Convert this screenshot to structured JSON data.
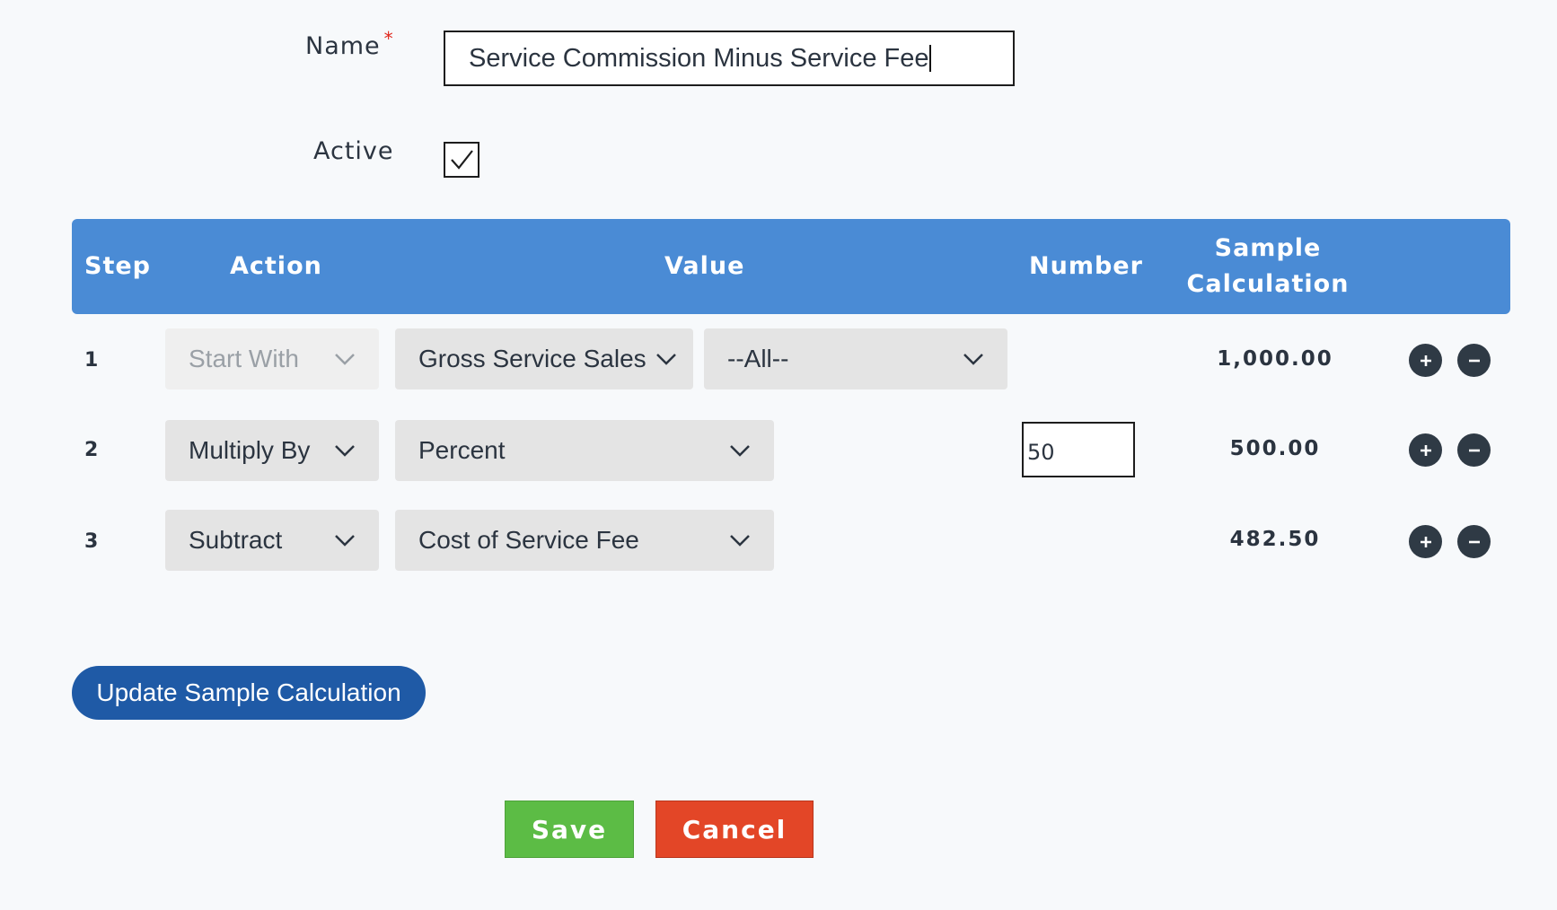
{
  "form": {
    "name_label": "Name",
    "name_required_marker": "*",
    "name_value": "Service Commission Minus Service Fee",
    "active_label": "Active",
    "active_checked": true
  },
  "table": {
    "headers": {
      "step": "Step",
      "action": "Action",
      "value": "Value",
      "number": "Number",
      "sample_line1": "Sample",
      "sample_line2": "Calculation"
    },
    "rows": [
      {
        "step": "1",
        "action": "Start With",
        "value": "Gross Service Sales",
        "value2": "--All--",
        "number": "",
        "sample": "1,000.00"
      },
      {
        "step": "2",
        "action": "Multiply By",
        "value": "Percent",
        "number": "50",
        "sample": "500.00"
      },
      {
        "step": "3",
        "action": "Subtract",
        "value": "Cost of Service Fee",
        "number": "",
        "sample": "482.50"
      }
    ]
  },
  "buttons": {
    "update": "Update Sample Calculation",
    "save": "Save",
    "cancel": "Cancel"
  },
  "icons": {
    "add": "plus-circle-icon",
    "remove": "minus-circle-icon",
    "dropdown": "chevron-down-icon",
    "check": "checkmark-icon"
  },
  "colors": {
    "header_bg": "#4a8bd5",
    "update_btn": "#1f5aa6",
    "save_btn": "#5cbc45",
    "cancel_btn": "#e34627",
    "required": "#e0261b"
  }
}
